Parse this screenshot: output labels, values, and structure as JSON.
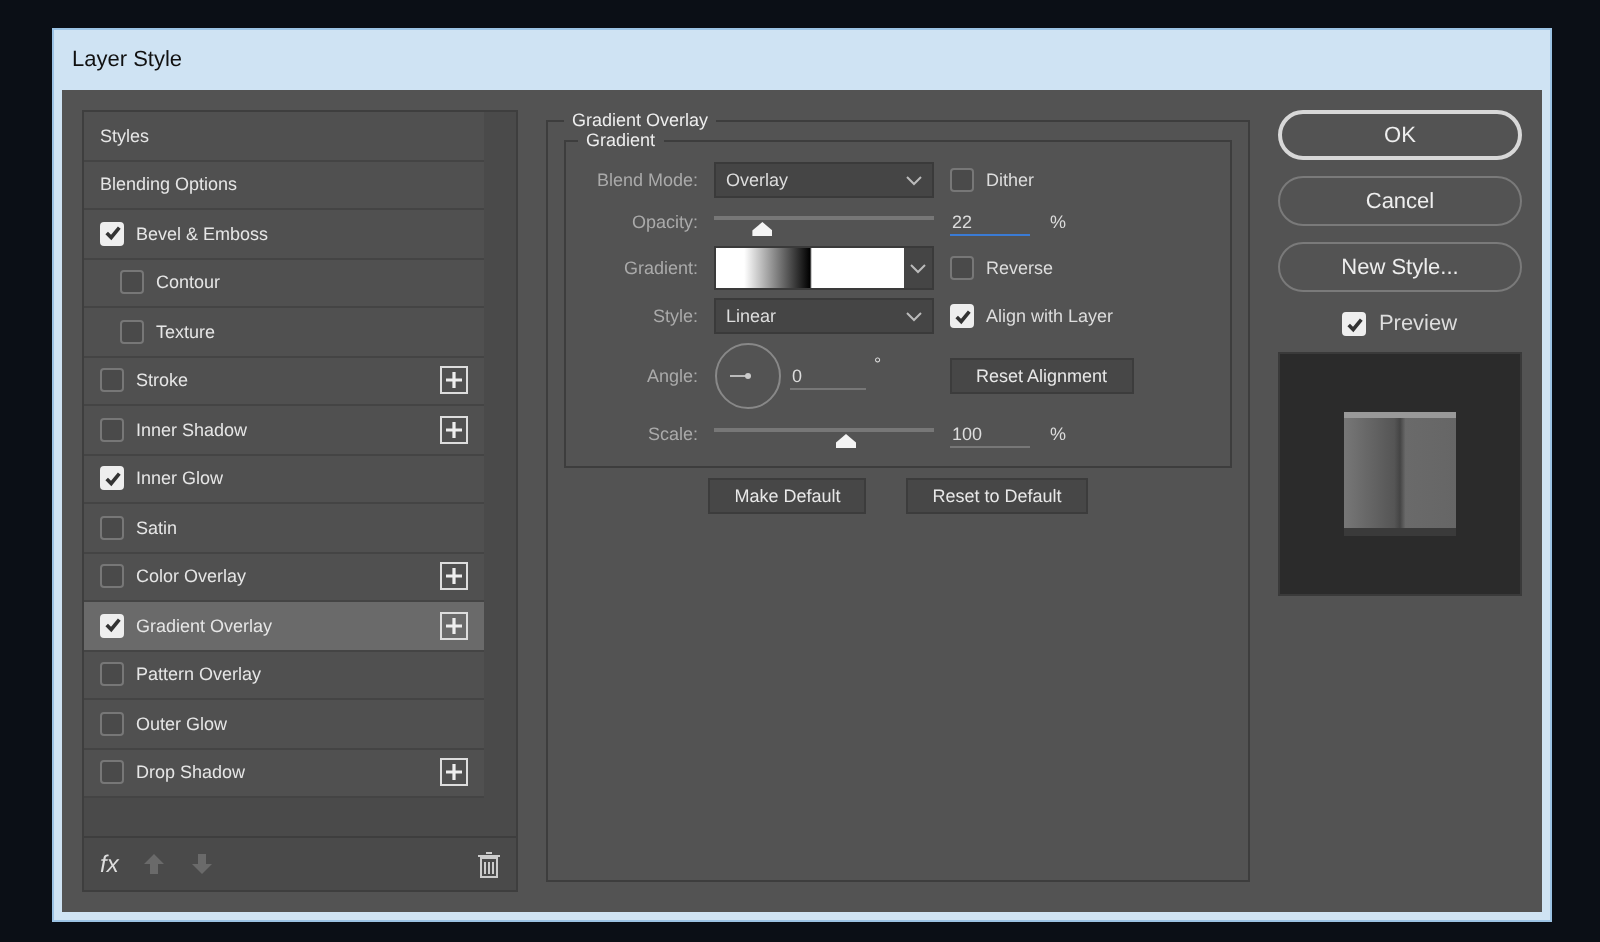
{
  "window": {
    "title": "Layer Style"
  },
  "styles_list": [
    {
      "label": "Styles",
      "kind": "plain",
      "selected": false
    },
    {
      "label": "Blending Options",
      "kind": "plain",
      "selected": false
    },
    {
      "label": "Bevel & Emboss",
      "kind": "check",
      "checked": true,
      "plus": false,
      "selected": false
    },
    {
      "label": "Contour",
      "kind": "sub",
      "checked": false,
      "plus": false,
      "selected": false
    },
    {
      "label": "Texture",
      "kind": "sub",
      "checked": false,
      "plus": false,
      "selected": false
    },
    {
      "label": "Stroke",
      "kind": "check",
      "checked": false,
      "plus": true,
      "selected": false
    },
    {
      "label": "Inner Shadow",
      "kind": "check",
      "checked": false,
      "plus": true,
      "selected": false
    },
    {
      "label": "Inner Glow",
      "kind": "check",
      "checked": true,
      "plus": false,
      "selected": false
    },
    {
      "label": "Satin",
      "kind": "check",
      "checked": false,
      "plus": false,
      "selected": false
    },
    {
      "label": "Color Overlay",
      "kind": "check",
      "checked": false,
      "plus": true,
      "selected": false
    },
    {
      "label": "Gradient Overlay",
      "kind": "check",
      "checked": true,
      "plus": true,
      "selected": true
    },
    {
      "label": "Pattern Overlay",
      "kind": "check",
      "checked": false,
      "plus": false,
      "selected": false
    },
    {
      "label": "Outer Glow",
      "kind": "check",
      "checked": false,
      "plus": false,
      "selected": false
    },
    {
      "label": "Drop Shadow",
      "kind": "check",
      "checked": false,
      "plus": true,
      "selected": false
    }
  ],
  "fx_label": "fx",
  "panel": {
    "title": "Gradient Overlay",
    "group": "Gradient",
    "blend_mode": {
      "label": "Blend Mode:",
      "value": "Overlay"
    },
    "dither": {
      "label": "Dither",
      "checked": false
    },
    "opacity": {
      "label": "Opacity:",
      "level": 0.22,
      "value": "22",
      "unit": "%"
    },
    "gradient": {
      "label": "Gradient:"
    },
    "reverse": {
      "label": "Reverse",
      "checked": false
    },
    "style": {
      "label": "Style:",
      "value": "Linear"
    },
    "align": {
      "label": "Align with Layer",
      "checked": true
    },
    "angle": {
      "label": "Angle:",
      "value": "0",
      "unit": "°"
    },
    "reset_alignment": "Reset Alignment",
    "scale": {
      "label": "Scale:",
      "level": 0.6,
      "value": "100",
      "unit": "%"
    },
    "buttons": [
      "Make Default",
      "Reset to Default"
    ]
  },
  "actions": [
    {
      "label": "OK",
      "default": true
    },
    {
      "label": "Cancel",
      "default": false
    },
    {
      "label": "New Style...",
      "default": false
    }
  ],
  "preview": {
    "label": "Preview",
    "checked": true
  }
}
